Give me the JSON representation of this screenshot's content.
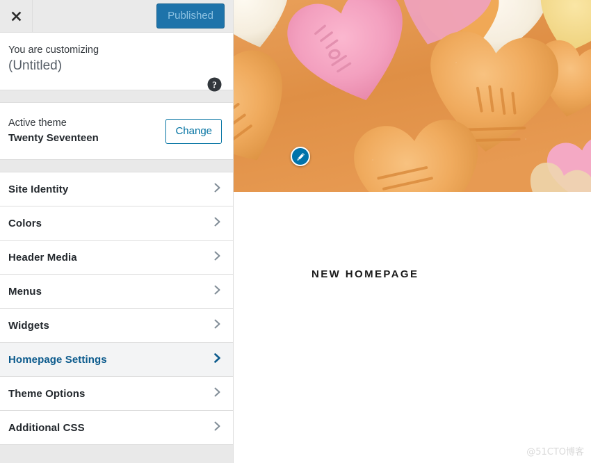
{
  "customizer": {
    "header": {
      "close_icon": "close-icon",
      "publish_label": "Published"
    },
    "intro": {
      "eyebrow": "You are customizing",
      "title": "(Untitled)",
      "help_icon": "help-icon"
    },
    "theme": {
      "eyebrow": "Active theme",
      "name": "Twenty Seventeen",
      "change_label": "Change"
    },
    "sections": [
      {
        "label": "Site Identity",
        "active": false
      },
      {
        "label": "Colors",
        "active": false
      },
      {
        "label": "Header Media",
        "active": false
      },
      {
        "label": "Menus",
        "active": false
      },
      {
        "label": "Widgets",
        "active": false
      },
      {
        "label": "Homepage Settings",
        "active": true
      },
      {
        "label": "Theme Options",
        "active": false
      },
      {
        "label": "Additional CSS",
        "active": false
      }
    ]
  },
  "preview": {
    "header_image_alt": "candy-hearts-header-image",
    "edit_shortcut_icon": "pencil-edit-icon",
    "entry_title": "NEW HOMEPAGE",
    "watermark": "@51CTO博客"
  },
  "colors": {
    "accent_blue": "#0073aa",
    "publish_bg": "#1e73aa",
    "active_text": "#0b5a8c",
    "active_row_bg": "#f3f4f5",
    "sidebar_bg": "#eeeeee",
    "border": "#dddddd"
  }
}
